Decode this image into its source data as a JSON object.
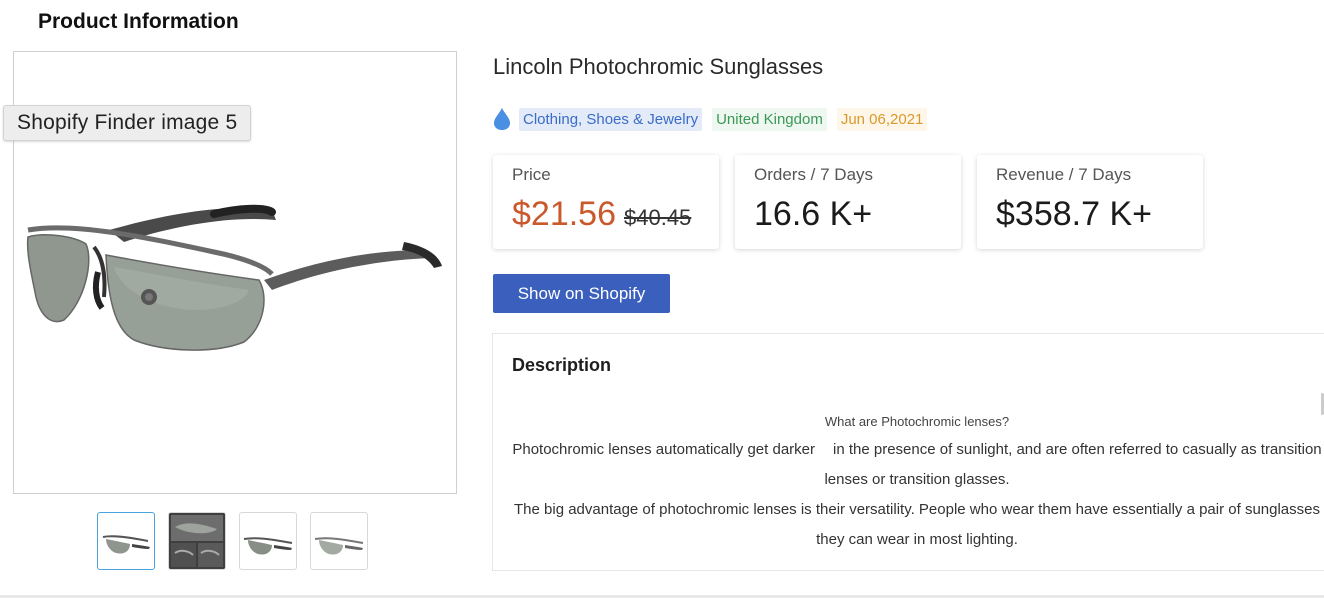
{
  "page": {
    "title": "Product Information"
  },
  "image_tooltip": "Shopify Finder image 5",
  "product": {
    "title": "Lincoln Photochromic Sunglasses",
    "tags": {
      "icon": "drop-icon",
      "category": "Clothing, Shoes & Jewelry",
      "country": "United Kingdom",
      "date": "Jun 06,2021"
    }
  },
  "stats": {
    "price": {
      "label": "Price",
      "current": "$21.56",
      "original": "$40.45"
    },
    "orders": {
      "label": "Orders / 7 Days",
      "value": "16.6 K+"
    },
    "revenue": {
      "label": "Revenue / 7 Days",
      "value": "$358.7 K+"
    }
  },
  "actions": {
    "show_on_shopify": "Show on Shopify"
  },
  "description": {
    "heading": "Description",
    "question": "What are Photochromic lenses?",
    "para1_a": "Photochromic lenses automatically get darker",
    "para1_b": "in the presence of sunlight, and are often referred to casually as transition lenses or transition glasses.",
    "para2": "The big advantage of photochromic lenses is their versatility. People who wear them have essentially a pair of sunglasses they can wear in most lighting."
  },
  "thumbnails": [
    {
      "icon": "sunglasses-thumbnail",
      "active": true
    },
    {
      "icon": "sunglasses-collage-thumbnail",
      "active": false
    },
    {
      "icon": "sunglasses-thumbnail",
      "active": false
    },
    {
      "icon": "sunglasses-thumbnail",
      "active": false
    }
  ],
  "colors": {
    "accent": "#3a5fbd",
    "price": "#c9582a",
    "category_tag": "#3b6cc9",
    "country_tag": "#3a9a55",
    "date_tag": "#d89a2c"
  }
}
